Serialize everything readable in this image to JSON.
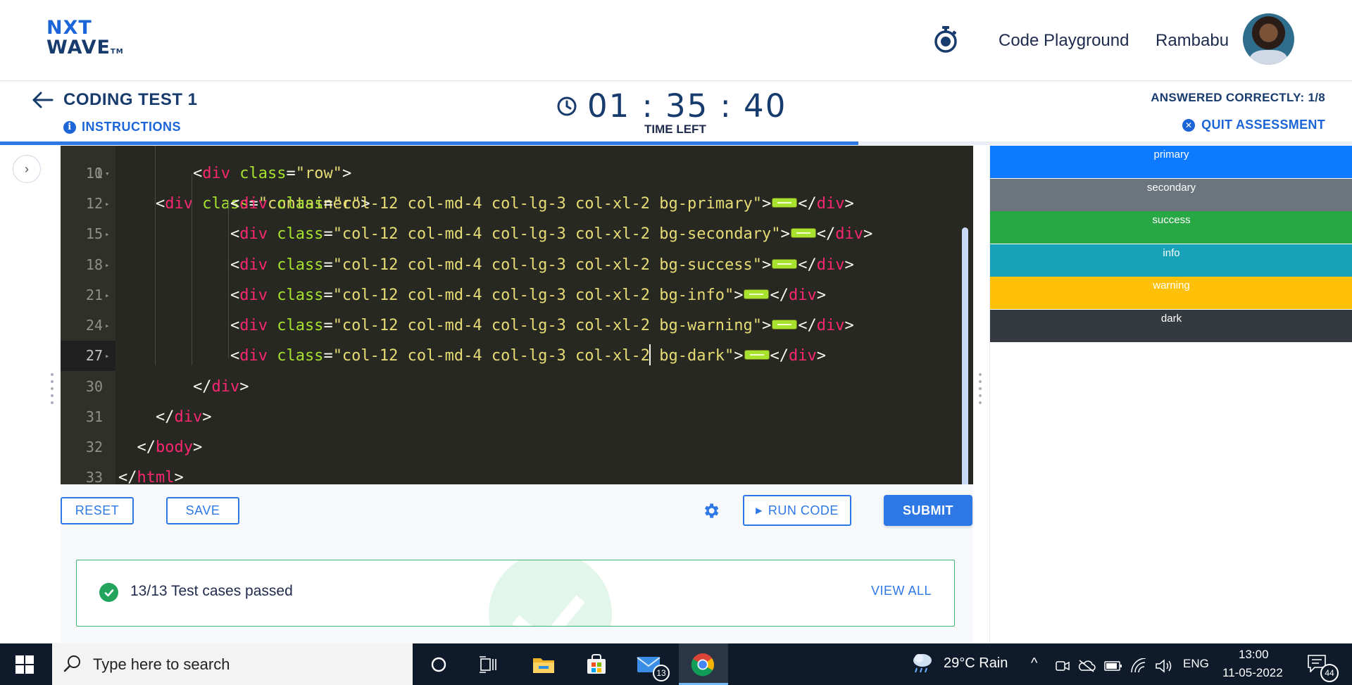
{
  "header": {
    "logo_line1": "NXT",
    "logo_line2": "WAVE",
    "logo_tm": "TM",
    "playground_label": "Code Playground",
    "username": "Rambabu"
  },
  "test": {
    "back_label": "back",
    "title": "CODING TEST 1",
    "instructions_label": "INSTRUCTIONS",
    "timer": "01 : 35 : 40",
    "time_left_label": "TIME LEFT",
    "answered_label": "ANSWERED CORRECTLY: 1/8",
    "quit_label": "QUIT ASSESSMENT",
    "progress_percent": 79.7
  },
  "editor": {
    "lines": [
      {
        "num": "11",
        "fold": "▾"
      },
      {
        "num": "12",
        "fold": "▸",
        "cls": "col-12 col-md-4 col-lg-3 col-xl-2 bg-primary"
      },
      {
        "num": "15",
        "fold": "▸",
        "cls": "col-12 col-md-4 col-lg-3 col-xl-2 bg-secondary"
      },
      {
        "num": "18",
        "fold": "▸",
        "cls": "col-12 col-md-4 col-lg-3 col-xl-2 bg-success"
      },
      {
        "num": "21",
        "fold": "▸",
        "cls": "col-12 col-md-4 col-lg-3 col-xl-2 bg-info"
      },
      {
        "num": "24",
        "fold": "▸",
        "cls": "col-12 col-md-4 col-lg-3 col-xl-2 bg-warning"
      },
      {
        "num": "27",
        "fold": "▸",
        "cls_a": "col-12 col-md-4 col-lg-3 col-xl-2",
        "cls_b": " bg-dark"
      },
      {
        "num": "30",
        "fold": ""
      },
      {
        "num": "31",
        "fold": ""
      },
      {
        "num": "32",
        "fold": ""
      },
      {
        "num": "33",
        "fold": ""
      }
    ],
    "row_class": "row",
    "tag_div": "div",
    "tag_body": "body",
    "tag_html": "html",
    "attr_class": "class"
  },
  "actions": {
    "reset_label": "RESET",
    "save_label": "SAVE",
    "run_label": "RUN CODE",
    "submit_label": "SUBMIT"
  },
  "result": {
    "text": "13/13 Test cases passed",
    "view_all_label": "VIEW ALL"
  },
  "output": {
    "bars": [
      {
        "label": "primary",
        "color": "#0d7aff"
      },
      {
        "label": "secondary",
        "color": "#6c757d"
      },
      {
        "label": "success",
        "color": "#28a745"
      },
      {
        "label": "info",
        "color": "#17a2b8"
      },
      {
        "label": "warning",
        "color": "#ffc107"
      },
      {
        "label": "dark",
        "color": "#343a40"
      }
    ]
  },
  "taskbar": {
    "search_placeholder": "Type here to search",
    "weather": "29°C  Rain",
    "lang": "ENG",
    "time": "13:00",
    "date": "11-05-2022",
    "mail_badge": "13",
    "notif_badge": "44"
  },
  "colors": {
    "brand_blue": "#2e78e6",
    "navy": "#183b6e",
    "success_green": "#22a45d"
  }
}
